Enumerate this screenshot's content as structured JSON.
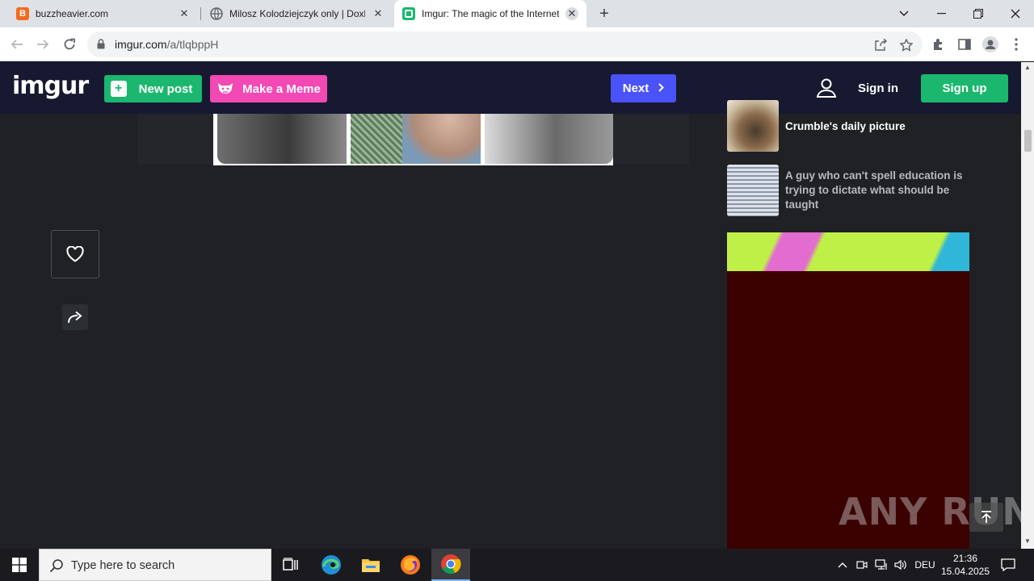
{
  "browser": {
    "tabs": [
      {
        "title": "buzzheavier.com",
        "favicon": "B",
        "favicon_color": "#f26b1d",
        "active": false
      },
      {
        "title": "Milosz Kolodziejczyk only | Doxbin",
        "favicon": "",
        "favicon_color": "#5f6368",
        "active": false
      },
      {
        "title": "Imgur: The magic of the Internet",
        "favicon": "",
        "favicon_color": "#1bb76e",
        "active": true
      }
    ],
    "url_host": "imgur.com",
    "url_path": "/a/tlqbppH"
  },
  "imgur": {
    "logo": "imgur",
    "new_post": "New post",
    "make_meme": "Make a Meme",
    "next": "Next",
    "sign_in": "Sign in",
    "sign_up": "Sign up",
    "brand_green": "#1bb76e",
    "brand_pink": "#f249b4",
    "brand_blue": "#4a52fa"
  },
  "sidebar": {
    "items": [
      {
        "title": "Crumble's daily picture"
      },
      {
        "title": "A guy who can't spell education is trying to dictate what should be taught"
      }
    ]
  },
  "watermark": "ANY RUN",
  "taskbar": {
    "search_placeholder": "Type here to search",
    "language": "DEU",
    "time": "21:36",
    "date": "15.04.2025"
  }
}
